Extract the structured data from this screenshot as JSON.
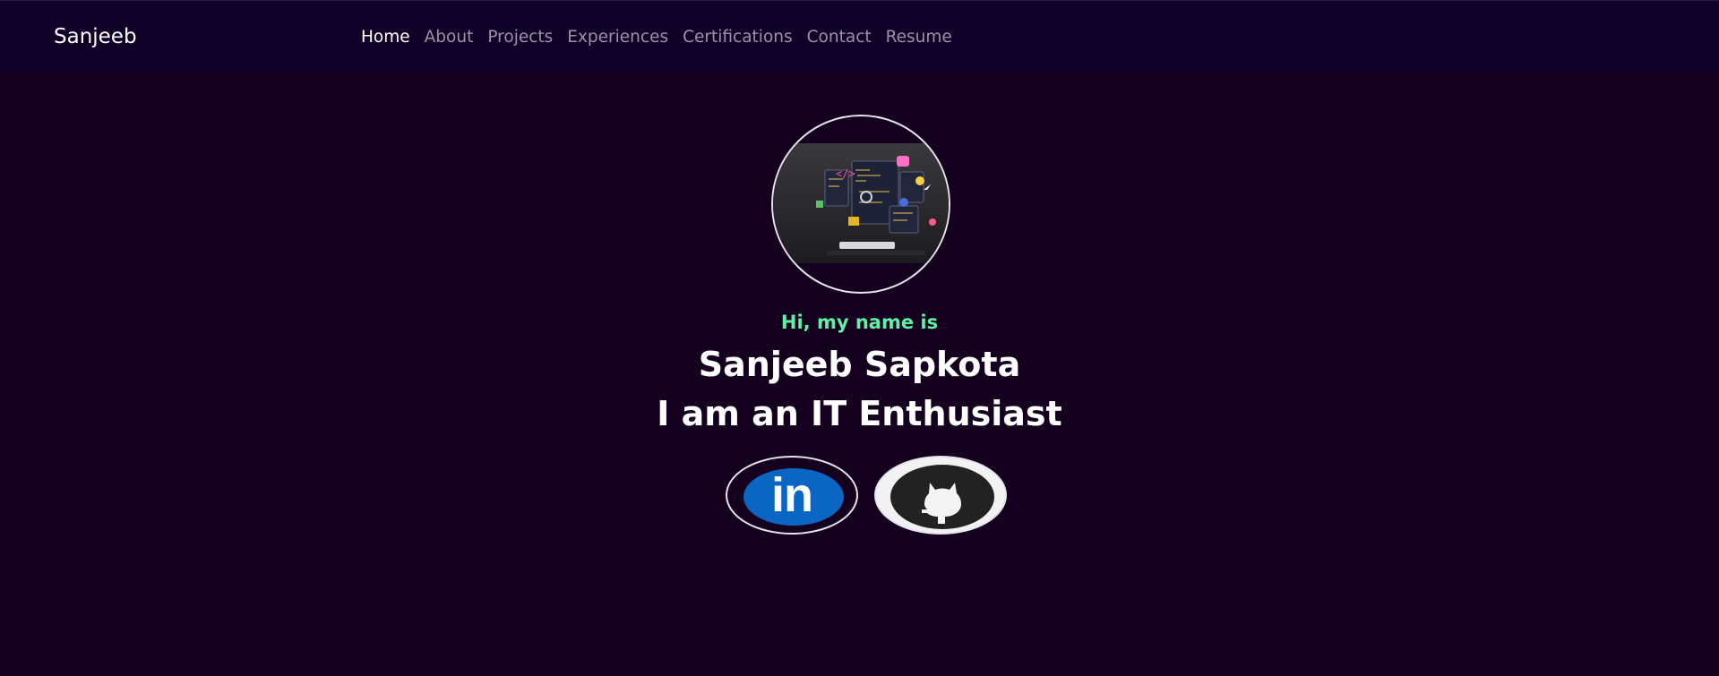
{
  "navbar": {
    "brand": "Sanjeeb",
    "links": [
      {
        "label": "Home",
        "active": true
      },
      {
        "label": "About",
        "active": false
      },
      {
        "label": "Projects",
        "active": false
      },
      {
        "label": "Experiences",
        "active": false
      },
      {
        "label": "Certifications",
        "active": false
      },
      {
        "label": "Contact",
        "active": false
      },
      {
        "label": "Resume",
        "active": false
      }
    ]
  },
  "hero": {
    "avatar_icon": "developer-workspace-illustration",
    "greeting": "Hi, my name is",
    "name": "Sanjeeb Sapkota",
    "role": "I am an IT Enthusiast"
  },
  "social": {
    "linkedin": {
      "label": "in",
      "icon": "linkedin-icon",
      "color": "#0a66c2"
    },
    "github": {
      "icon": "github-icon",
      "color": "#222222"
    }
  },
  "colors": {
    "background": "#14001e",
    "navbar": "#0f0028",
    "accent": "#5ef2a6"
  }
}
